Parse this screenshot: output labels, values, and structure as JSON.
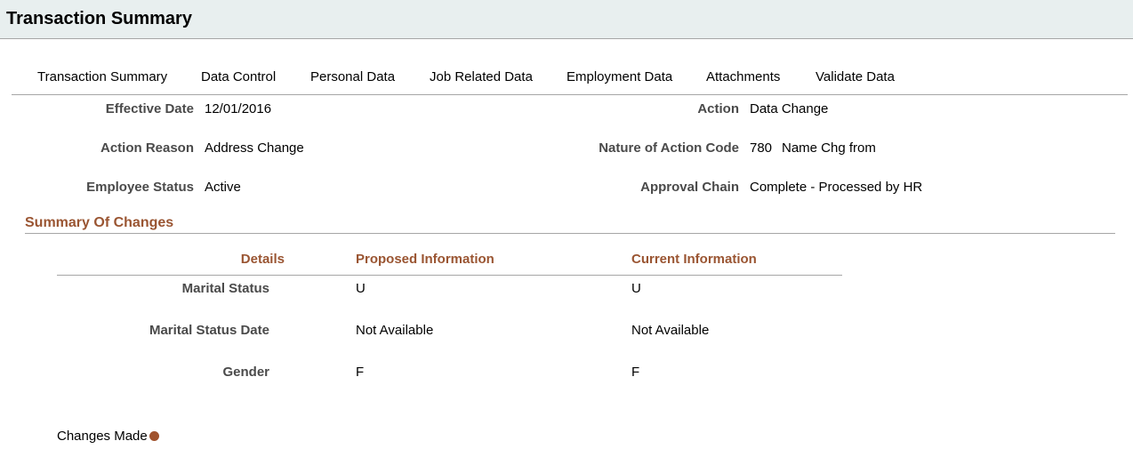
{
  "header": {
    "title": "Transaction Summary"
  },
  "tabs": [
    {
      "label": "Transaction Summary"
    },
    {
      "label": "Data Control"
    },
    {
      "label": "Personal Data"
    },
    {
      "label": "Job Related Data"
    },
    {
      "label": "Employment Data"
    },
    {
      "label": "Attachments"
    },
    {
      "label": "Validate Data"
    }
  ],
  "info": {
    "effective_date": {
      "label": "Effective Date",
      "value": "12/01/2016"
    },
    "action_reason": {
      "label": "Action Reason",
      "value": "Address Change"
    },
    "employee_status": {
      "label": "Employee Status",
      "value": "Active"
    },
    "action": {
      "label": "Action",
      "value": "Data Change"
    },
    "nature_of_action": {
      "label": "Nature of Action Code",
      "code": "780",
      "value": "Name Chg from"
    },
    "approval_chain": {
      "label": "Approval Chain",
      "value": "Complete - Processed by HR"
    }
  },
  "summary": {
    "title": "Summary Of Changes",
    "headers": {
      "details": "Details",
      "proposed": "Proposed Information",
      "current": "Current Information"
    },
    "rows": [
      {
        "label": "Marital Status",
        "proposed": "U",
        "current": "U"
      },
      {
        "label": "Marital Status Date",
        "proposed": "Not Available",
        "current": "Not Available"
      },
      {
        "label": "Gender",
        "proposed": "F",
        "current": "F"
      }
    ]
  },
  "legend": {
    "label": "Changes Made",
    "dot_color": "#a0522d"
  }
}
